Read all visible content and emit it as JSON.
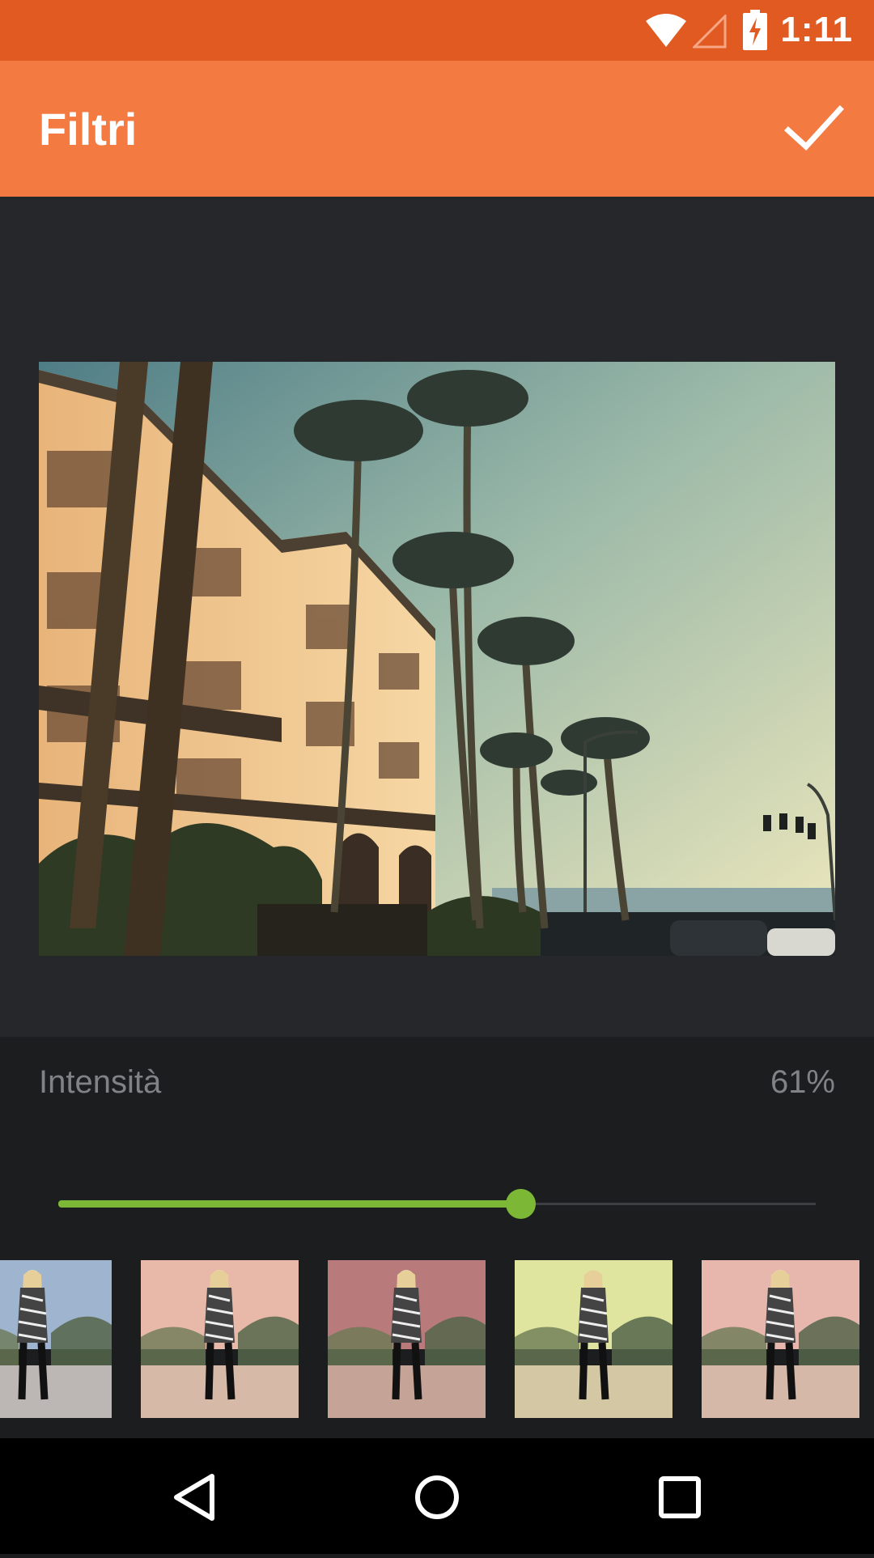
{
  "status_bar": {
    "time": "1:11",
    "icons": [
      "wifi-icon",
      "cell-signal-icon",
      "battery-charging-icon"
    ]
  },
  "app_bar": {
    "title": "Filtri",
    "confirm_icon": "check-icon"
  },
  "controls": {
    "intensity_label": "Intensità",
    "intensity_value": "61%",
    "slider_fraction": 0.61
  },
  "filters": [
    {
      "name": "filter-thumb-1",
      "tint": "#9fb4cf"
    },
    {
      "name": "filter-thumb-2",
      "tint": "#e8b9a9"
    },
    {
      "name": "filter-thumb-3",
      "tint": "#b87a7a"
    },
    {
      "name": "filter-thumb-4",
      "tint": "#dfe59e"
    },
    {
      "name": "filter-thumb-5",
      "tint": "#e7b7ad"
    }
  ],
  "nav_bar": {
    "icons": [
      "back-icon",
      "home-icon",
      "recents-icon"
    ]
  },
  "colors": {
    "status_bar": "#e05a22",
    "app_bar": "#f37a41",
    "accent": "#7cb836"
  }
}
